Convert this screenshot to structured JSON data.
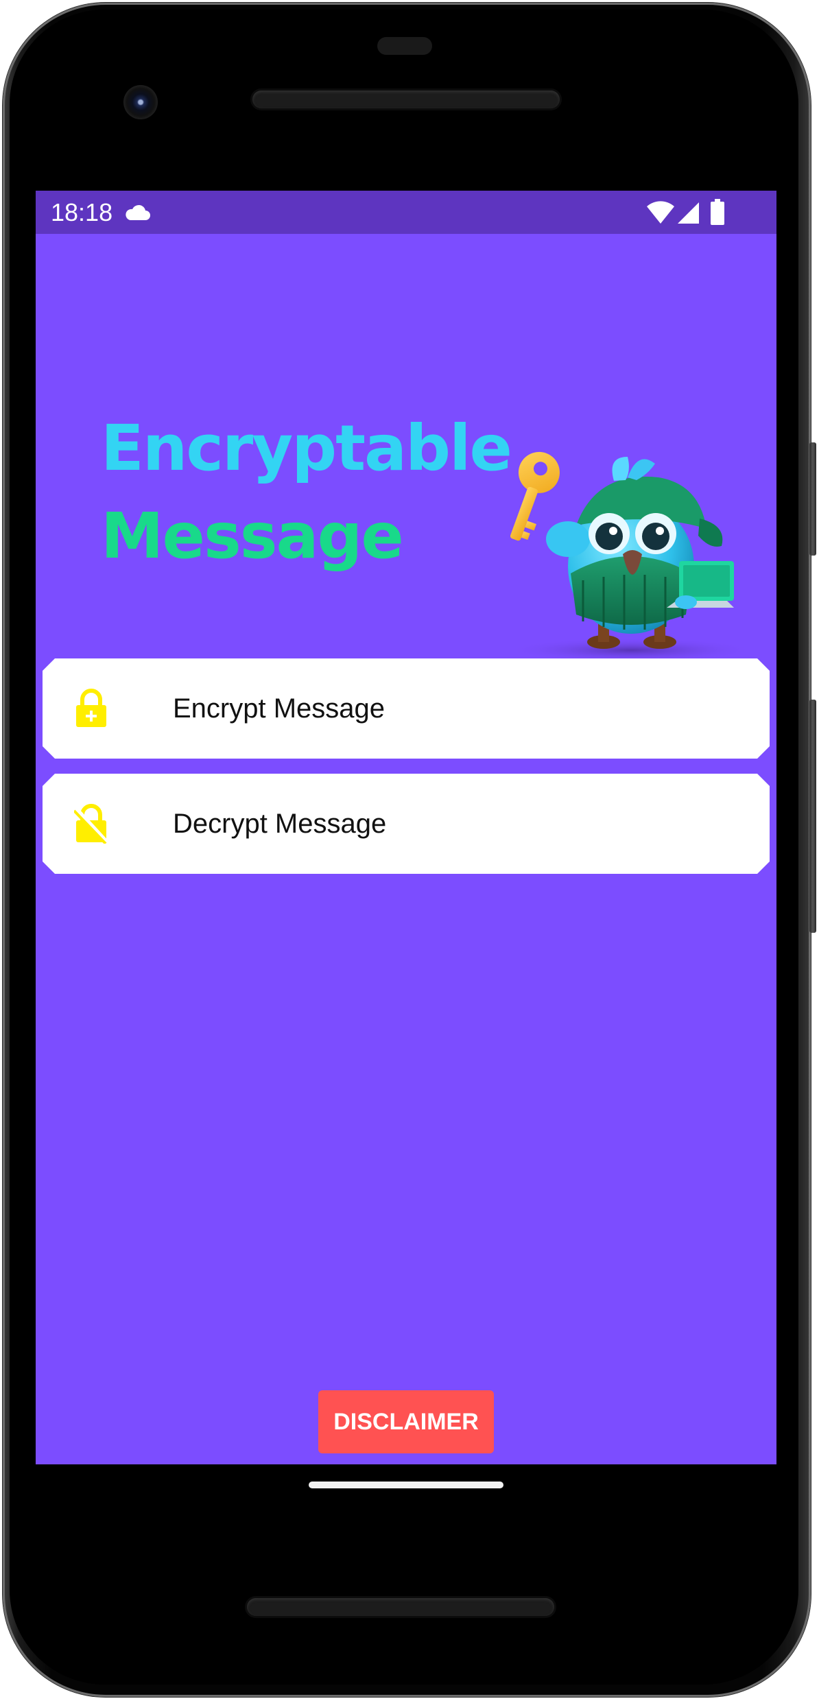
{
  "status_bar": {
    "time": "18:18",
    "icons": [
      "cloud-icon",
      "wifi-icon",
      "cell-signal-icon",
      "battery-icon"
    ],
    "background": "#5e35c0"
  },
  "header": {
    "title_line_1": "Encryptable",
    "title_line_2": "Message",
    "title_color_1": "#33d4f3",
    "title_color_2": "#19d98a",
    "mascot": "owl-mascot-with-key-and-laptop"
  },
  "menu": {
    "items": [
      {
        "label": "Encrypt Message",
        "icon": "lock-plus-icon"
      },
      {
        "label": "Decrypt Message",
        "icon": "lock-off-icon"
      }
    ],
    "icon_color": "#ffee00"
  },
  "footer": {
    "disclaimer_label": "DISCLAIMER",
    "disclaimer_color": "#ff5252"
  },
  "theme": {
    "background": "#7c4dff"
  }
}
